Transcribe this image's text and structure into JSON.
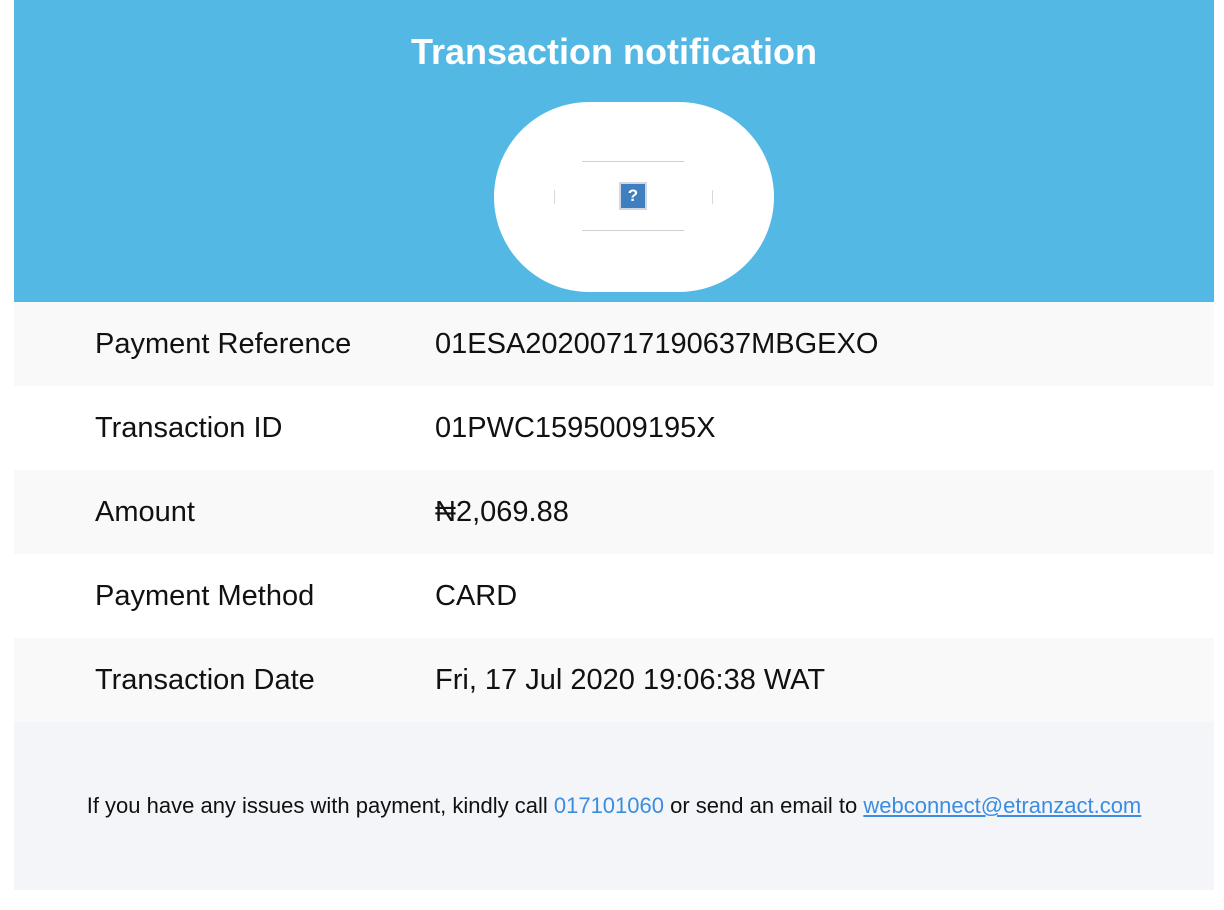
{
  "header": {
    "title": "Transaction notification",
    "background_color": "#53b8e4",
    "logo_icon": "broken-image-icon",
    "logo_glyph": "?"
  },
  "details": [
    {
      "label": "Payment Reference",
      "value": "01ESA20200717190637MBGEXO"
    },
    {
      "label": "Transaction ID",
      "value": "01PWC1595009195X"
    },
    {
      "label": "Amount",
      "value": "₦2,069.88"
    },
    {
      "label": "Payment Method",
      "value": "CARD"
    },
    {
      "label": "Transaction Date",
      "value": "Fri, 17 Jul 2020 19:06:38 WAT"
    }
  ],
  "footer": {
    "text_before": "If you have any issues with payment, kindly call ",
    "phone": "017101060",
    "text_middle": " or send an email to ",
    "email": "webconnect@etranzact.com",
    "link_color": "#3a8de0"
  }
}
